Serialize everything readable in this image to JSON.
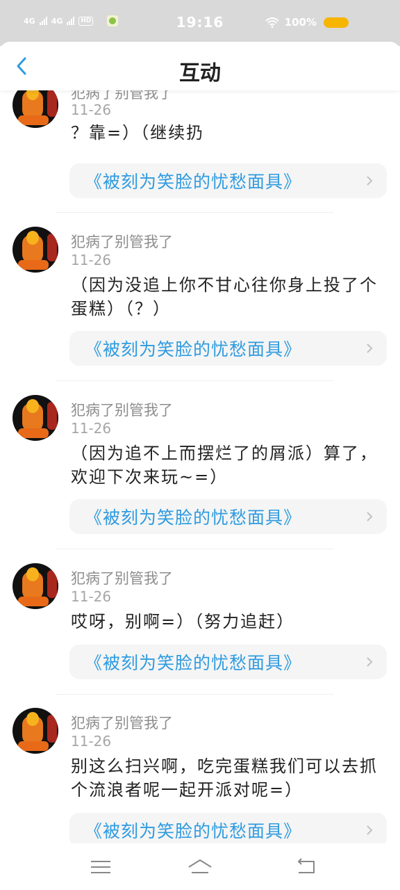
{
  "status_bar": {
    "signal1": "4G",
    "signal2": "4G",
    "hd": "HD",
    "time": "19:16",
    "battery_text": "100%",
    "battery_color": "#f7b500"
  },
  "header": {
    "title": "互动",
    "back_icon": "chevron-left-icon"
  },
  "items": [
    {
      "user": "犯病了别管我了",
      "date": "11-26",
      "text": "？靠=）（继续扔",
      "card": "《被刻为笑脸的忧愁面具》"
    },
    {
      "user": "犯病了别管我了",
      "date": "11-26",
      "text": "（因为没追上你不甘心往你身上投了个蛋糕）（？）",
      "card": "《被刻为笑脸的忧愁面具》"
    },
    {
      "user": "犯病了别管我了",
      "date": "11-26",
      "text": "（因为追不上而摆烂了的屑派）算了，欢迎下次来玩~=）",
      "card": "《被刻为笑脸的忧愁面具》"
    },
    {
      "user": "犯病了别管我了",
      "date": "11-26",
      "text": "哎呀，别啊=）（努力追赶）",
      "card": "《被刻为笑脸的忧愁面具》"
    },
    {
      "user": "犯病了别管我了",
      "date": "11-26",
      "text": "别这么扫兴啊，吃完蛋糕我们可以去抓个流浪者呢一起开派对呢=）",
      "card": "《被刻为笑脸的忧愁面具》"
    }
  ],
  "nav": {
    "menu_icon": "menu-icon",
    "home_icon": "home-icon",
    "back_icon": "back-icon"
  },
  "colors": {
    "accent": "#2f9be0",
    "card_bg": "#f5f5f5",
    "status_bar": "#d9d9d9"
  }
}
